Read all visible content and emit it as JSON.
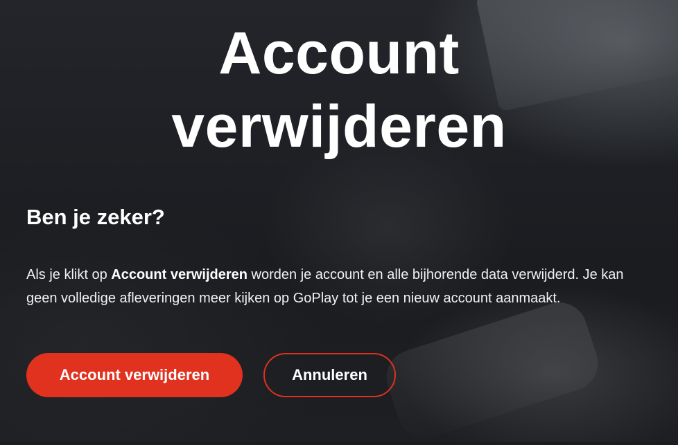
{
  "page": {
    "title_line1": "Account",
    "title_line2": "verwijderen",
    "subtitle": "Ben je zeker?",
    "body": {
      "prefix": "Als je klikt op ",
      "emphasis": "Account verwijderen",
      "suffix": " worden je account en alle bijhorende data verwijderd. Je kan geen volledige afleveringen meer kijken op GoPlay tot je een nieuw account aanmaakt."
    }
  },
  "buttons": {
    "delete_label": "Account verwijderen",
    "cancel_label": "Annuleren"
  },
  "colors": {
    "accent": "#e1311f",
    "background": "#1b1d21",
    "text": "#ffffff"
  }
}
